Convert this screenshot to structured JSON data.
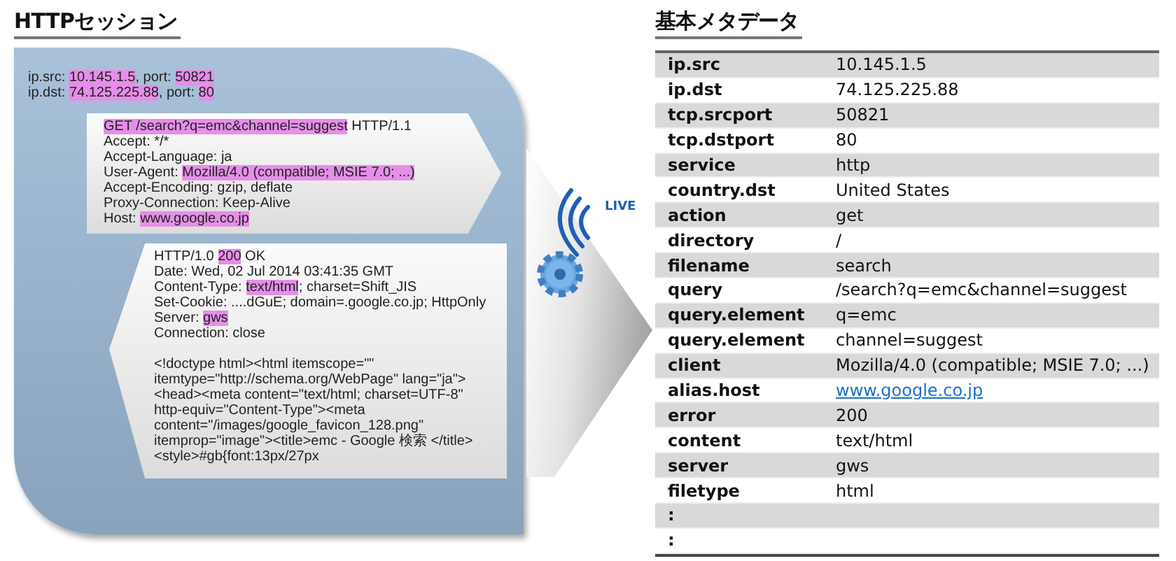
{
  "session": {
    "title": "HTTPセッション",
    "endpoints": [
      {
        "segments": [
          {
            "text": "ip.src: ",
            "highlighted": false
          },
          {
            "text": "10.145.1.5",
            "highlighted": true
          },
          {
            "text": ", port: ",
            "highlighted": false
          },
          {
            "text": "50821",
            "highlighted": true
          }
        ]
      },
      {
        "segments": [
          {
            "text": "ip.dst: ",
            "highlighted": false
          },
          {
            "text": "74.125.225.88",
            "highlighted": true
          },
          {
            "text": ", port: ",
            "highlighted": false
          },
          {
            "text": "80",
            "highlighted": true
          }
        ]
      }
    ],
    "request": [
      {
        "segments": [
          {
            "text": "GET /search?q=emc&channel=suggest",
            "highlighted": true
          },
          {
            "text": " HTTP/1.1",
            "highlighted": false
          }
        ]
      },
      {
        "segments": [
          {
            "text": "Accept: */*",
            "highlighted": false
          }
        ]
      },
      {
        "segments": [
          {
            "text": "Accept-Language: ja",
            "highlighted": false
          }
        ]
      },
      {
        "segments": [
          {
            "text": "User-Agent: ",
            "highlighted": false
          },
          {
            "text": "Mozilla/4.0 (compatible; MSIE 7.0; ...)",
            "highlighted": true
          }
        ]
      },
      {
        "segments": [
          {
            "text": "Accept-Encoding: gzip, deflate",
            "highlighted": false
          }
        ]
      },
      {
        "segments": [
          {
            "text": "Proxy-Connection: Keep-Alive",
            "highlighted": false
          }
        ]
      },
      {
        "segments": [
          {
            "text": "Host: ",
            "highlighted": false
          },
          {
            "text": "www.google.co.jp",
            "highlighted": true
          }
        ]
      }
    ],
    "response": [
      {
        "segments": [
          {
            "text": "HTTP/1.0 ",
            "highlighted": false
          },
          {
            "text": "200",
            "highlighted": true
          },
          {
            "text": " OK",
            "highlighted": false
          }
        ]
      },
      {
        "segments": [
          {
            "text": "Date: Wed, 02 Jul 2014 03:41:35 GMT",
            "highlighted": false
          }
        ]
      },
      {
        "segments": [
          {
            "text": "Content-Type: ",
            "highlighted": false
          },
          {
            "text": "text/html",
            "highlighted": true
          },
          {
            "text": "; charset=Shift_JIS",
            "highlighted": false
          }
        ]
      },
      {
        "segments": [
          {
            "text": "Set-Cookie: ....dGuE; domain=.google.co.jp; HttpOnly",
            "highlighted": false
          }
        ]
      },
      {
        "segments": [
          {
            "text": "Server: ",
            "highlighted": false
          },
          {
            "text": "gws",
            "highlighted": true
          }
        ]
      },
      {
        "segments": [
          {
            "text": "Connection: close",
            "highlighted": false
          }
        ]
      }
    ],
    "body": "<!doctype html><html itemscope=\"\" itemtype=\"http://schema.org/WebPage\" lang=\"ja\"><head><meta content=\"text/html; charset=UTF-8\" http-equiv=\"Content-Type\"><meta content=\"/images/google_favicon_128.png\" itemprop=\"image\"><title>emc - Google 検索 </title><style>#gb{font:13px/27px"
  },
  "live_label": "LIVE",
  "metadata": {
    "title": "基本メタデータ",
    "rows": [
      {
        "key": "ip.src",
        "value": "10.145.1.5"
      },
      {
        "key": "ip.dst",
        "value": "74.125.225.88"
      },
      {
        "key": "tcp.srcport",
        "value": "50821"
      },
      {
        "key": "tcp.dstport",
        "value": "80"
      },
      {
        "key": "service",
        "value": "http"
      },
      {
        "key": "country.dst",
        "value": "United States"
      },
      {
        "key": "action",
        "value": "get"
      },
      {
        "key": "directory",
        "value": "/"
      },
      {
        "key": "filename",
        "value": "search"
      },
      {
        "key": "query",
        "value": "/search?q=emc&channel=suggest"
      },
      {
        "key": "query.element",
        "value": "q=emc"
      },
      {
        "key": "query.element",
        "value": "channel=suggest"
      },
      {
        "key": "client",
        "value": "Mozilla/4.0 (compatible; MSIE 7.0; ...)"
      },
      {
        "key": "alias.host",
        "value": "www.google.co.jp",
        "link": true
      },
      {
        "key": "error",
        "value": "200"
      },
      {
        "key": "content",
        "value": "text/html"
      },
      {
        "key": "server",
        "value": "gws"
      },
      {
        "key": "filetype",
        "value": "html"
      },
      {
        "key": ":"
      },
      {
        "key": ":"
      }
    ]
  }
}
